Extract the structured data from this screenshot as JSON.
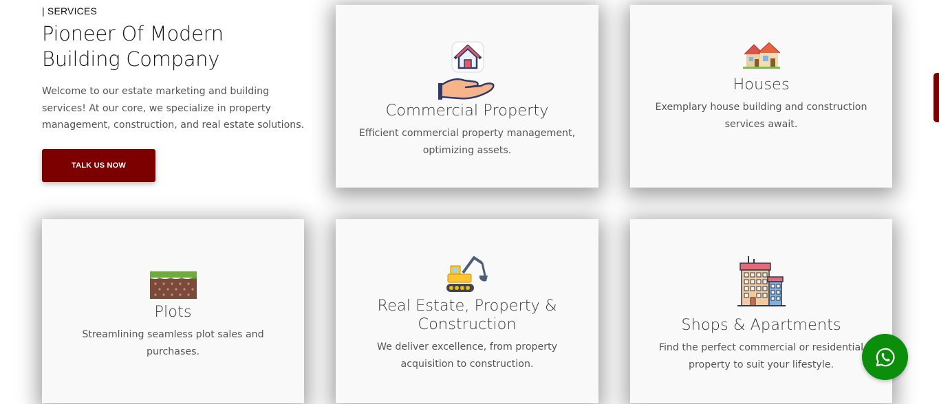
{
  "intro": {
    "eyebrow": "| SERVICES",
    "headline_line1": "Pioneer Of Modern",
    "headline_line2": "Building Company",
    "description": "Welcome to our estate marketing and building services! At our core, we specialize in property management, construction, and real estate solutions.",
    "cta_label": "TALK US NOW"
  },
  "cards": [
    {
      "icon": "house-in-hand-icon",
      "title": "Commercial Property",
      "description": "Efficient commercial property management, optimizing assets."
    },
    {
      "icon": "houses-icon",
      "title": "Houses",
      "description": "Exemplary house building and construction services await."
    },
    {
      "icon": "soil-plot-icon",
      "title": "Plots",
      "description": "Streamlining seamless plot sales and purchases."
    },
    {
      "icon": "excavator-icon",
      "title": "Real Estate, Property & Construction",
      "description": "We deliver excellence, from property acquisition to construction."
    },
    {
      "icon": "apartment-building-icon",
      "title": "Shops & Apartments",
      "description": "Find the perfect commercial or residential property to suit your lifestyle."
    }
  ],
  "floating": {
    "whatsapp_icon": "whatsapp-icon",
    "side_tab_icon": "side-tab"
  },
  "colors": {
    "accent": "#7d0000",
    "whatsapp": "#0b8e0b",
    "card_bg": "#f9f9f9"
  }
}
